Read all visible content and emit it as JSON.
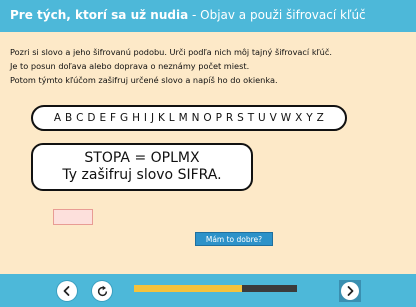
{
  "header": {
    "title_bold": "Pre tých, ktorí sa už nudia",
    "title_sub": " - Objav a použi šifrovací kľúč"
  },
  "instructions": [
    "Pozri si slovo a jeho šifrovanú podobu. Urči podľa nich môj tajný šifrovací kľúč.",
    "Je to posun doľava alebo doprava o neznámy počet miest.",
    "Potom týmto kľúčom zašifruj určené slovo a napíš ho do okienka."
  ],
  "alphabet": "A B C D E F G H I J K L M N O P R S T U V W X Y Z",
  "example": {
    "line1": "STOPA = OPLMX",
    "line2": "Ty zašifruj slovo SIFRA."
  },
  "answer": {
    "value": ""
  },
  "check_button": "Mám to dobre?",
  "progress": {
    "fraction": 0.66
  },
  "icons": {
    "prev": "chevron-left-icon",
    "reload": "reload-icon",
    "next": "chevron-right-icon"
  },
  "colors": {
    "header": "#4db8d9",
    "background": "#fde9c8",
    "progress_fill": "#f5c23b",
    "check_button": "#2d92c9"
  }
}
